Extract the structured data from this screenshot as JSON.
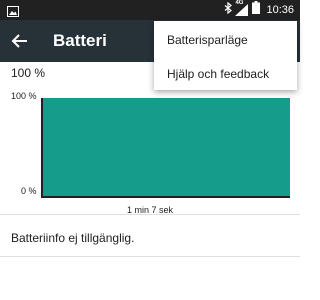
{
  "status_bar": {
    "time": "10:36",
    "network_label": "4G",
    "icons": [
      "image-icon",
      "bluetooth-icon",
      "signal-icon",
      "battery-icon"
    ]
  },
  "app_bar": {
    "title": "Batteri",
    "back_icon": "arrow-back-icon",
    "background": "#263238"
  },
  "battery": {
    "level_text": "100 %",
    "info_text": "Batteriinfo ej tillgänglig."
  },
  "chart_data": {
    "type": "area",
    "y_tick_labels": [
      "100 %",
      "0 %"
    ],
    "ylim": [
      0,
      100
    ],
    "x_label": "1 min 7 sek",
    "series": [
      {
        "values": [
          100,
          100
        ]
      }
    ],
    "color": "#159c8a"
  },
  "menu": {
    "items": [
      {
        "label": "Batterisparläge"
      },
      {
        "label": "Hjälp och feedback"
      }
    ]
  }
}
